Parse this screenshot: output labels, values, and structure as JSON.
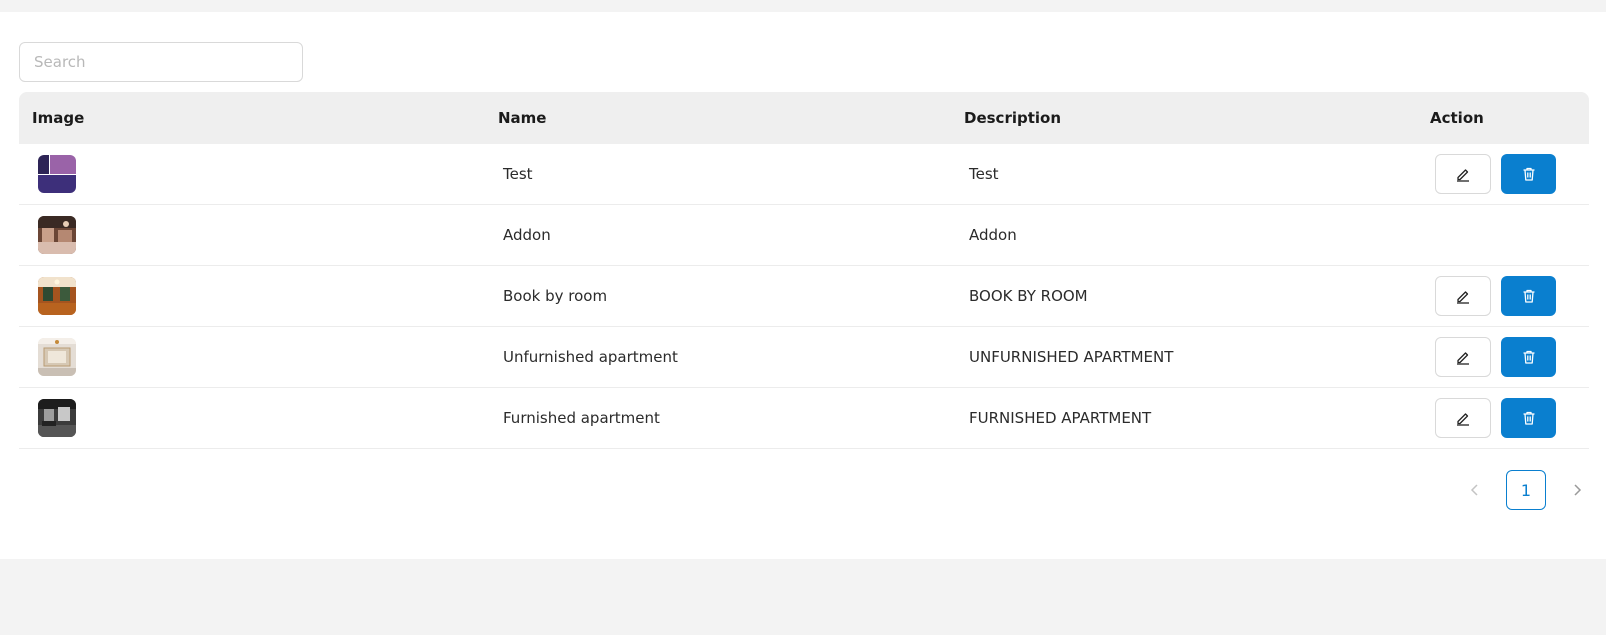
{
  "search": {
    "placeholder": "Search",
    "value": ""
  },
  "table": {
    "headers": {
      "image": "Image",
      "name": "Name",
      "description": "Description",
      "action": "Action"
    },
    "rows": [
      {
        "name": "Test",
        "description": "Test",
        "has_actions": true
      },
      {
        "name": "Addon",
        "description": "Addon",
        "has_actions": false
      },
      {
        "name": "Book by room",
        "description": "BOOK BY ROOM",
        "has_actions": true
      },
      {
        "name": "Unfurnished apartment",
        "description": "UNFURNISHED APARTMENT",
        "has_actions": true
      },
      {
        "name": "Furnished apartment",
        "description": "FURNISHED APARTMENT",
        "has_actions": true
      }
    ]
  },
  "actions": {
    "edit_icon": "pencil-icon",
    "delete_icon": "trash-icon"
  },
  "pagination": {
    "current_page": "1"
  },
  "colors": {
    "accent": "#0a7fcf",
    "header_bg": "#efefef",
    "page_bg": "#f3f3f3"
  }
}
